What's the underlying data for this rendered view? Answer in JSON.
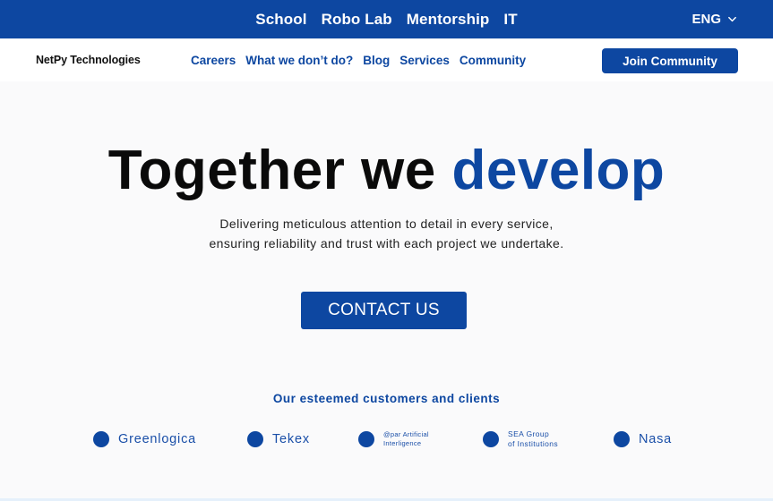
{
  "top_bar": {
    "links": [
      "School",
      "Robo Lab",
      "Mentorship",
      "IT"
    ],
    "language": "ENG",
    "color": "#0d47a1"
  },
  "nav": {
    "brand": "NetPy Technologies",
    "links": [
      "Careers",
      "What we don’t do?",
      "Blog",
      "Services",
      "Community"
    ],
    "join_label": "Join Community"
  },
  "hero": {
    "title_main": "Together we",
    "title_accent": "develop",
    "subtitle_line1": "Delivering meticulous attention to detail in every service,",
    "subtitle_line2": "ensuring reliability and trust with each project we undertake.",
    "cta_label": "CONTACT US"
  },
  "clients": {
    "heading": "Our esteemed customers and clients",
    "items": [
      {
        "name": "Greenlogica"
      },
      {
        "name": "Tekex"
      },
      {
        "name": "@par Artificial\nInterligence"
      },
      {
        "name": "SEA Group\nof Institutions"
      },
      {
        "name": "Nasa"
      }
    ]
  }
}
